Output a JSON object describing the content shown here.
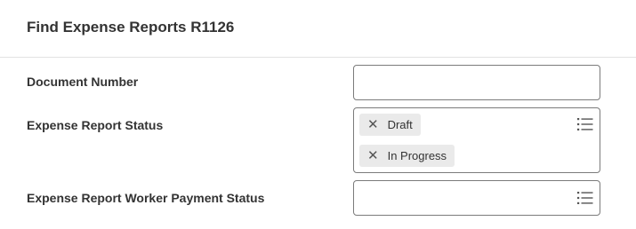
{
  "dialog": {
    "title": "Find Expense Reports R1126"
  },
  "fields": {
    "document_number": {
      "label": "Document Number",
      "value": ""
    },
    "expense_report_status": {
      "label": "Expense Report Status",
      "chips": [
        {
          "label": "Draft",
          "remove_glyph": "✕"
        },
        {
          "label": "In Progress",
          "remove_glyph": "✕"
        }
      ],
      "icon": "prompt-list-icon"
    },
    "worker_payment_status": {
      "label": "Expense Report Worker Payment Status",
      "value": "",
      "icon": "prompt-list-icon"
    }
  },
  "colors": {
    "border": "#7b7b7b",
    "chip_bg": "#eaeaea",
    "text": "#333333",
    "divider": "#e2e2e2"
  }
}
